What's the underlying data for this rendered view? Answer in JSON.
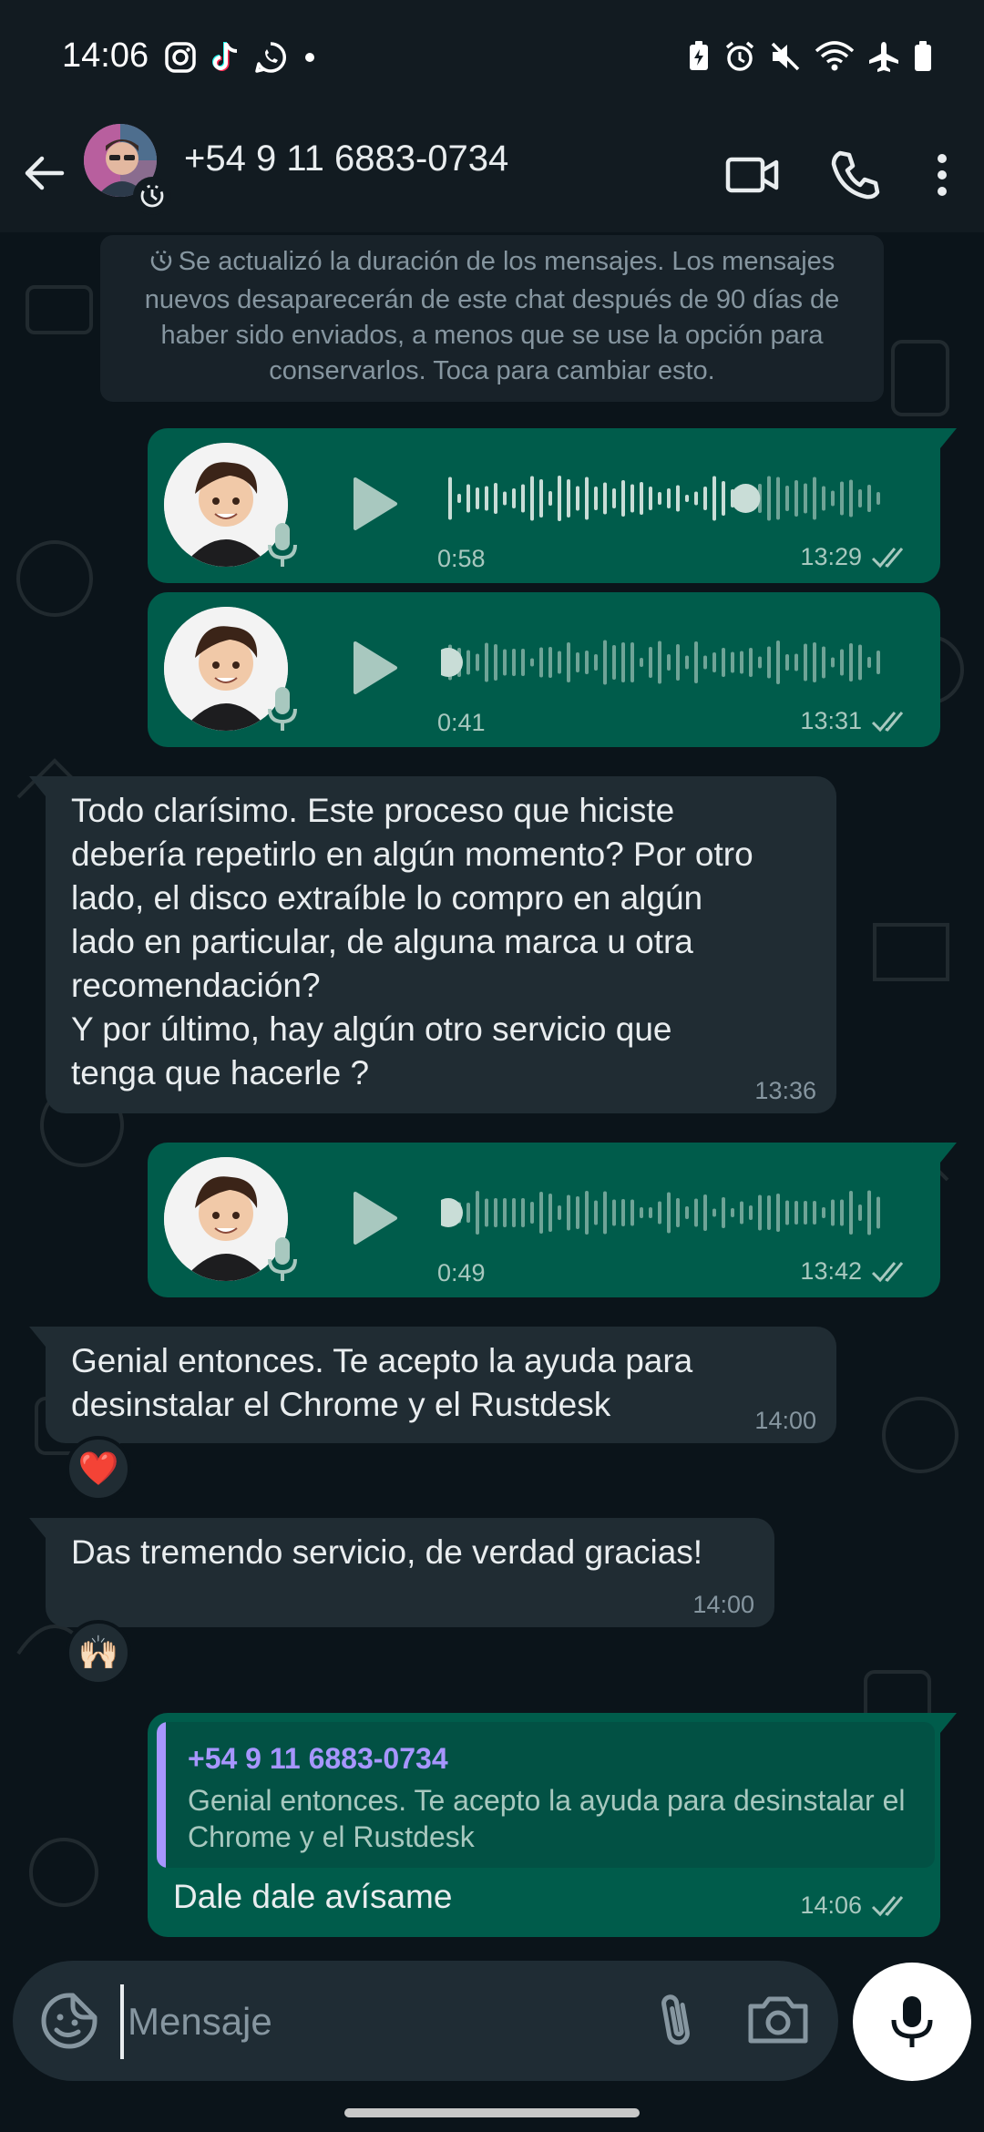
{
  "status_bar": {
    "time": "14:06"
  },
  "header": {
    "contact_name": "+54 9 11 6883-0734"
  },
  "system_notice": {
    "text": "Se actualizó la duración de los mensajes. Los mensajes nuevos desaparecerán de este chat después de 90 días de haber sido enviados, a menos que se use la opción para conservarlos. Toca para cambiar esto."
  },
  "messages": {
    "voice1": {
      "duration": "0:58",
      "time": "13:29",
      "progress": 0.68
    },
    "voice2": {
      "duration": "0:41",
      "time": "13:31",
      "progress": 0.0
    },
    "text1": {
      "text": "Todo clarísimo. Este proceso que hiciste\ndebería repetirlo en algún momento? Por otro\nlado, el disco extraíble lo compro en algún\nlado en particular, de alguna marca u otra\nrecomendación?\nY por último, hay algún otro servicio que\ntenga que hacerle ?",
      "time": "13:36"
    },
    "voice3": {
      "duration": "0:49",
      "time": "13:42",
      "progress": 0.0
    },
    "text2": {
      "text": "Genial entonces. Te acepto la ayuda para\ndesinstalar el Chrome y el Rustdesk",
      "time": "14:00",
      "reaction": "❤️"
    },
    "text3": {
      "text": "Das tremendo servicio, de verdad gracias!",
      "time": "14:00",
      "reaction": "🙌🏻"
    },
    "reply1": {
      "quote_author": "+54 9 11 6883-0734",
      "quote_text": "Genial entonces. Te acepto la ayuda para desinstalar el Chrome y el Rustdesk",
      "text": "Dale dale avísame",
      "time": "14:06"
    }
  },
  "input": {
    "placeholder": "Mensaje"
  },
  "colors": {
    "background": "#0b141a",
    "bubble_out": "#005c4b",
    "bubble_in": "#202c33",
    "read_ticks": "#a8c8bf",
    "quote_accent": "#a796ff"
  },
  "icons": {
    "status_left": [
      "instagram-icon",
      "tiktok-icon",
      "whatsapp-icon",
      "notification-dot-icon"
    ],
    "status_right": [
      "battery-saver-icon",
      "alarm-icon",
      "mute-icon",
      "wifi-icon",
      "airplane-icon",
      "battery-icon"
    ],
    "header": [
      "back-arrow-icon",
      "video-call-icon",
      "phone-icon",
      "more-vert-icon"
    ],
    "input": [
      "sticker-icon",
      "paperclip-icon",
      "camera-icon",
      "mic-icon"
    ]
  }
}
